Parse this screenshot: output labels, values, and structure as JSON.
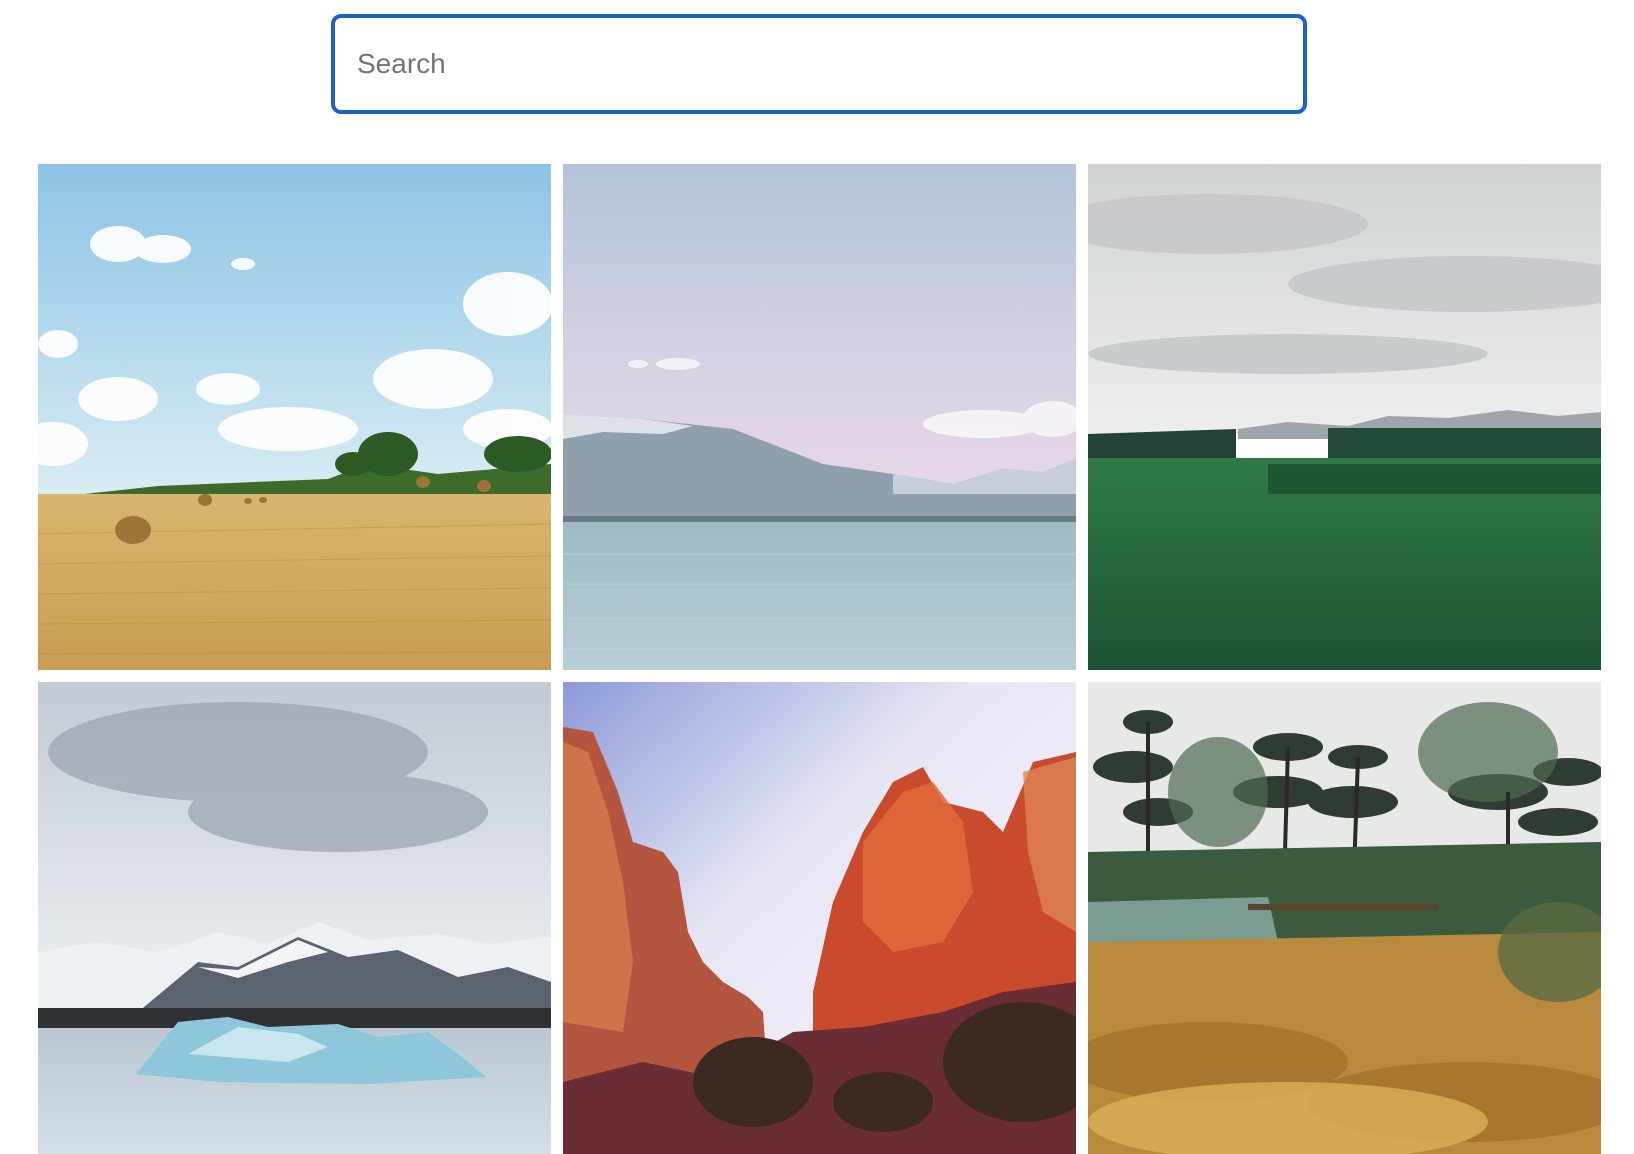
{
  "search": {
    "placeholder": "Search",
    "value": ""
  },
  "gallery": {
    "photos": [
      {
        "subject": "hay-field",
        "colors": {
          "sky": "#a9d3ea",
          "ground": "#d4ae66"
        }
      },
      {
        "subject": "mountain-lake",
        "colors": {
          "sky": "#c9cde0",
          "water": "#a9c4cd"
        }
      },
      {
        "subject": "green-plain",
        "colors": {
          "sky": "#d9dcdc",
          "ground": "#24603c"
        }
      },
      {
        "subject": "glacier-lagoon",
        "colors": {
          "sky": "#cfd8e0",
          "ice": "#8fc7da"
        }
      },
      {
        "subject": "red-canyon",
        "colors": {
          "sky": "#e9e0f0",
          "rock": "#c4472c"
        }
      },
      {
        "subject": "garden-trees",
        "colors": {
          "sky": "#e6e8e3",
          "ground": "#b98a3e"
        }
      }
    ]
  }
}
